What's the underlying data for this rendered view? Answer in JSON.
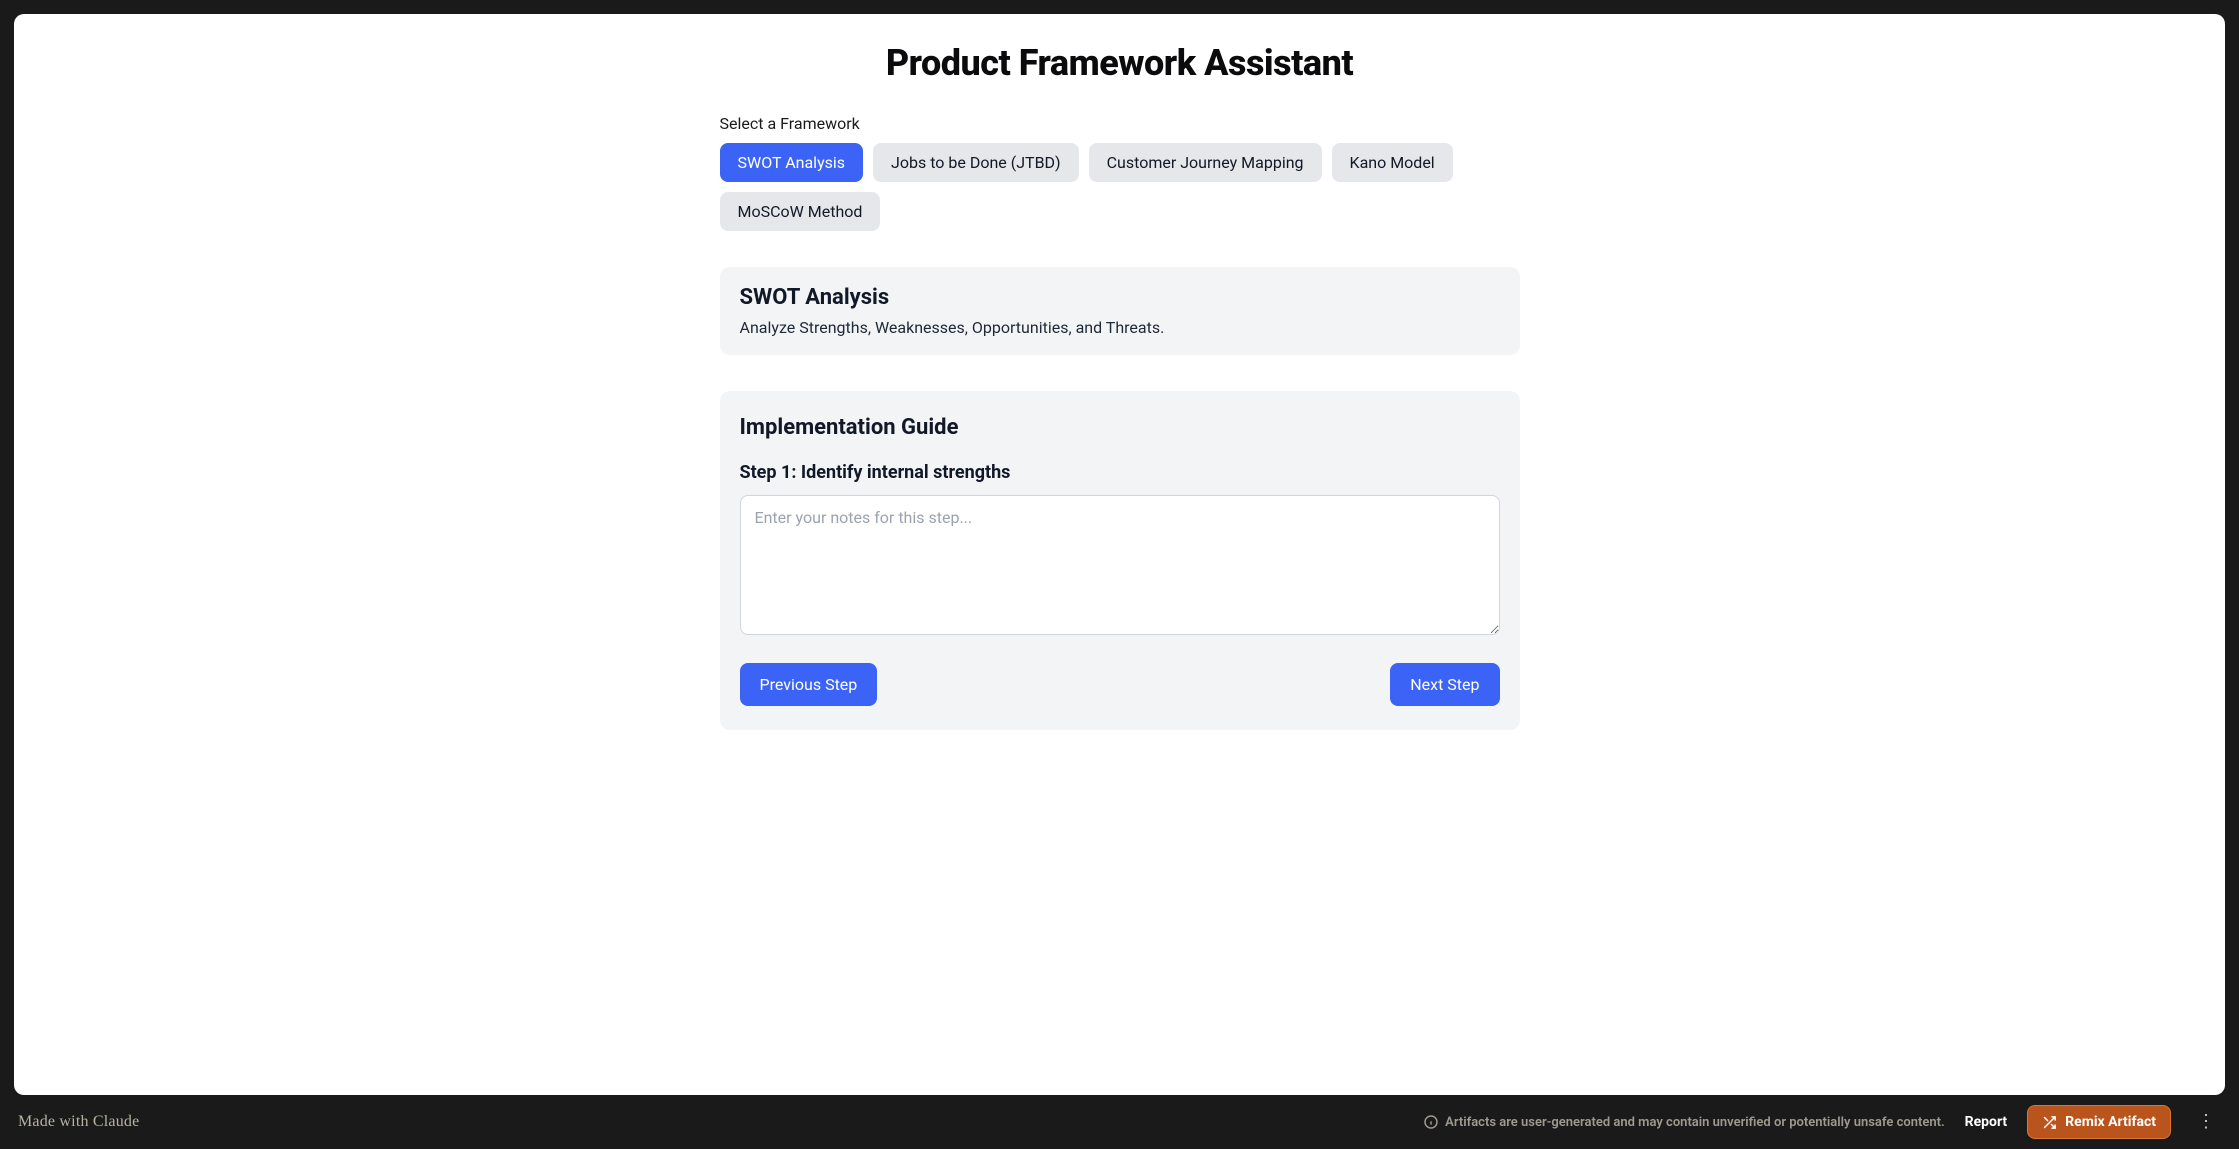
{
  "page": {
    "title": "Product Framework Assistant",
    "selectLabel": "Select a Framework"
  },
  "frameworks": [
    {
      "label": "SWOT Analysis",
      "active": true
    },
    {
      "label": "Jobs to be Done (JTBD)",
      "active": false
    },
    {
      "label": "Customer Journey Mapping",
      "active": false
    },
    {
      "label": "Kano Model",
      "active": false
    },
    {
      "label": "MoSCoW Method",
      "active": false
    }
  ],
  "selected": {
    "title": "SWOT Analysis",
    "description": "Analyze Strengths, Weaknesses, Opportunities, and Threats."
  },
  "guide": {
    "title": "Implementation Guide",
    "stepLabel": "Step 1: Identify internal strengths",
    "placeholder": "Enter your notes for this step...",
    "value": "",
    "prevLabel": "Previous Step",
    "nextLabel": "Next Step"
  },
  "footer": {
    "madeWith": "Made with Claude",
    "disclaimer": "Artifacts are user-generated and may contain unverified or potentially unsafe content.",
    "report": "Report",
    "remix": "Remix Artifact"
  },
  "colors": {
    "accent": "#3b63f6",
    "pillInactive": "#e5e7eb",
    "cardBg": "#f3f4f6",
    "remix": "#b9541d"
  }
}
